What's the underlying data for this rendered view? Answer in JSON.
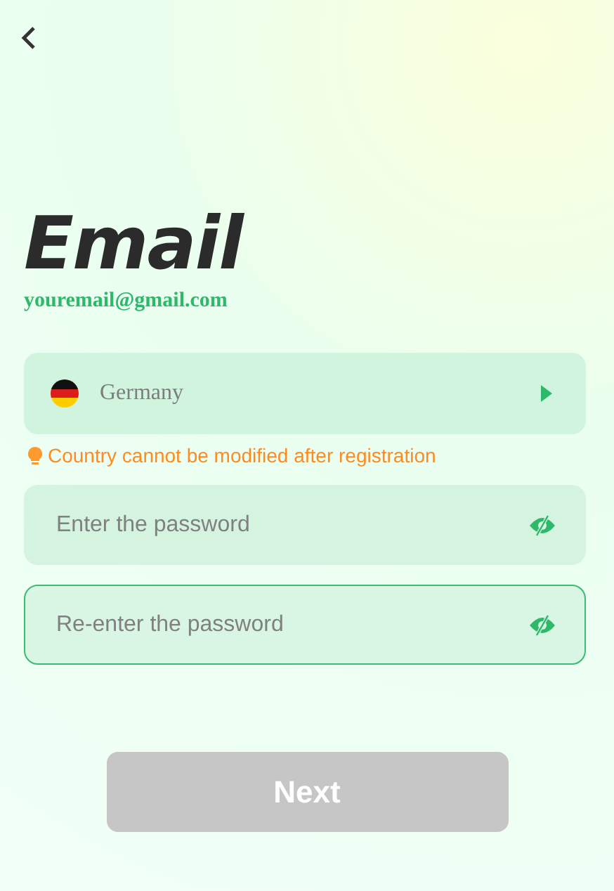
{
  "title": "Email",
  "email": "youremail@gmail.com",
  "country": {
    "value": "Germany"
  },
  "notice": "Country cannot be modified after registration",
  "fields": [
    {
      "placeholder": "Enter the password",
      "focused": false
    },
    {
      "placeholder": "Re-enter the password",
      "focused": true
    }
  ],
  "next_button": {
    "label": "Next",
    "disabled": true
  }
}
